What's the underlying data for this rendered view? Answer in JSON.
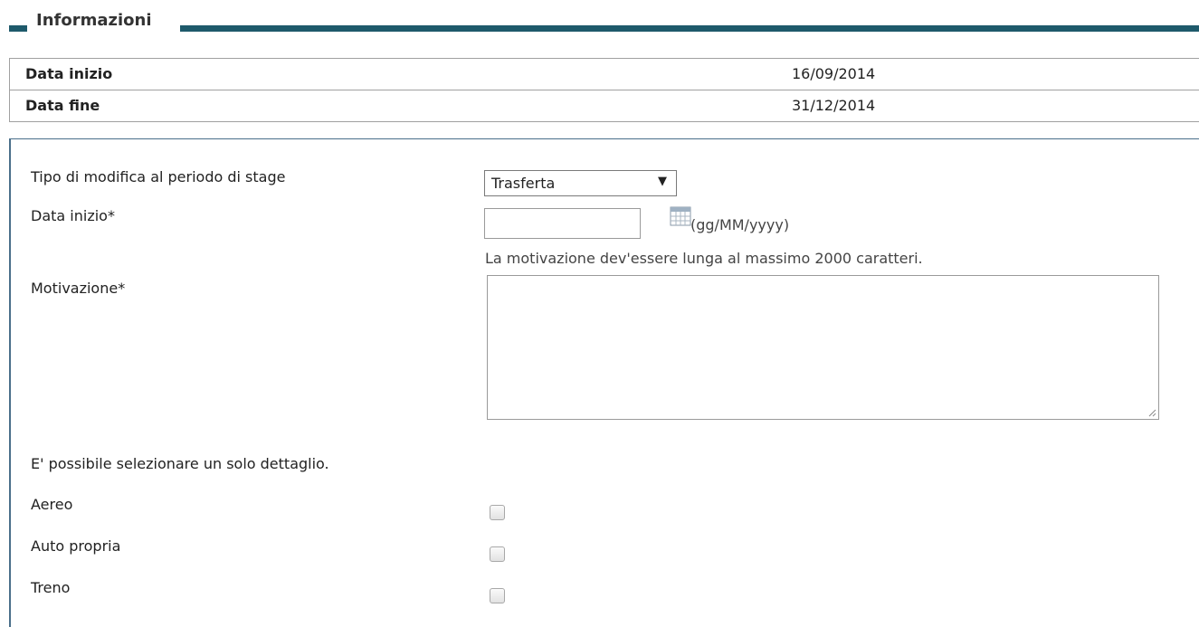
{
  "section": {
    "title": "Informazioni"
  },
  "info": [
    {
      "label": "Data inizio",
      "value": "16/09/2014"
    },
    {
      "label": "Data fine",
      "value": "31/12/2014"
    }
  ],
  "form": {
    "tipo_label": "Tipo di modifica al periodo di stage",
    "tipo_selected": "Trasferta",
    "data_inizio_label": "Data inizio*",
    "data_inizio_value": "",
    "date_format_hint": "(gg/MM/yyyy)",
    "motivazione_note": "La motivazione dev'essere lunga al massimo 2000 caratteri.",
    "motivazione_label": "Motivazione*",
    "motivazione_value": "",
    "detail_hint": "E' possibile selezionare un solo dettaglio.",
    "options": [
      {
        "label": "Aereo",
        "checked": false
      },
      {
        "label": "Auto propria",
        "checked": false
      },
      {
        "label": "Treno",
        "checked": false
      }
    ]
  },
  "icons": {
    "calendar": "calendar-icon",
    "dropdown": "triangle-down",
    "resize": "resize-grip"
  },
  "colors": {
    "accent": "#1e5a6b",
    "panel_border": "#4a6f8a"
  }
}
